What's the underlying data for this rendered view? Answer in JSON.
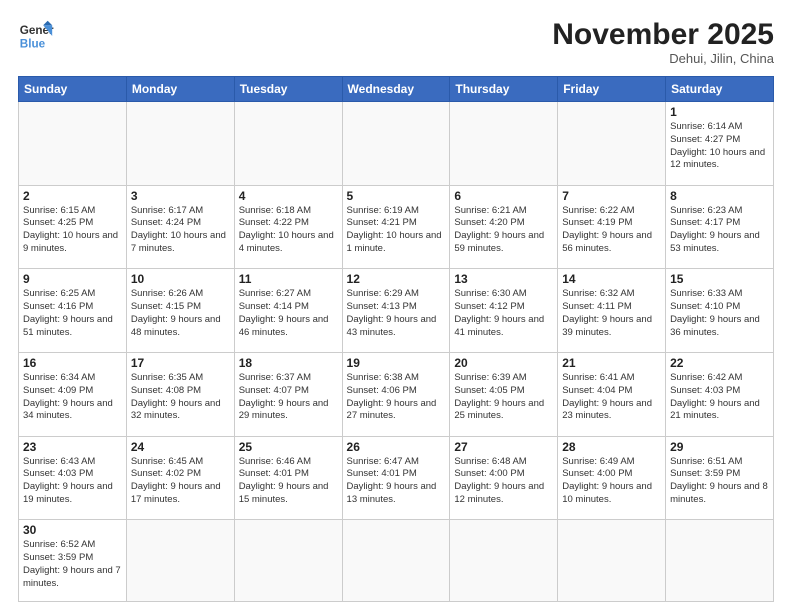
{
  "header": {
    "logo_general": "General",
    "logo_blue": "Blue",
    "month_title": "November 2025",
    "location": "Dehui, Jilin, China"
  },
  "weekdays": [
    "Sunday",
    "Monday",
    "Tuesday",
    "Wednesday",
    "Thursday",
    "Friday",
    "Saturday"
  ],
  "weeks": [
    [
      {
        "day": "",
        "info": ""
      },
      {
        "day": "",
        "info": ""
      },
      {
        "day": "",
        "info": ""
      },
      {
        "day": "",
        "info": ""
      },
      {
        "day": "",
        "info": ""
      },
      {
        "day": "",
        "info": ""
      },
      {
        "day": "1",
        "info": "Sunrise: 6:14 AM\nSunset: 4:27 PM\nDaylight: 10 hours and 12 minutes."
      }
    ],
    [
      {
        "day": "2",
        "info": "Sunrise: 6:15 AM\nSunset: 4:25 PM\nDaylight: 10 hours and 9 minutes."
      },
      {
        "day": "3",
        "info": "Sunrise: 6:17 AM\nSunset: 4:24 PM\nDaylight: 10 hours and 7 minutes."
      },
      {
        "day": "4",
        "info": "Sunrise: 6:18 AM\nSunset: 4:22 PM\nDaylight: 10 hours and 4 minutes."
      },
      {
        "day": "5",
        "info": "Sunrise: 6:19 AM\nSunset: 4:21 PM\nDaylight: 10 hours and 1 minute."
      },
      {
        "day": "6",
        "info": "Sunrise: 6:21 AM\nSunset: 4:20 PM\nDaylight: 9 hours and 59 minutes."
      },
      {
        "day": "7",
        "info": "Sunrise: 6:22 AM\nSunset: 4:19 PM\nDaylight: 9 hours and 56 minutes."
      },
      {
        "day": "8",
        "info": "Sunrise: 6:23 AM\nSunset: 4:17 PM\nDaylight: 9 hours and 53 minutes."
      }
    ],
    [
      {
        "day": "9",
        "info": "Sunrise: 6:25 AM\nSunset: 4:16 PM\nDaylight: 9 hours and 51 minutes."
      },
      {
        "day": "10",
        "info": "Sunrise: 6:26 AM\nSunset: 4:15 PM\nDaylight: 9 hours and 48 minutes."
      },
      {
        "day": "11",
        "info": "Sunrise: 6:27 AM\nSunset: 4:14 PM\nDaylight: 9 hours and 46 minutes."
      },
      {
        "day": "12",
        "info": "Sunrise: 6:29 AM\nSunset: 4:13 PM\nDaylight: 9 hours and 43 minutes."
      },
      {
        "day": "13",
        "info": "Sunrise: 6:30 AM\nSunset: 4:12 PM\nDaylight: 9 hours and 41 minutes."
      },
      {
        "day": "14",
        "info": "Sunrise: 6:32 AM\nSunset: 4:11 PM\nDaylight: 9 hours and 39 minutes."
      },
      {
        "day": "15",
        "info": "Sunrise: 6:33 AM\nSunset: 4:10 PM\nDaylight: 9 hours and 36 minutes."
      }
    ],
    [
      {
        "day": "16",
        "info": "Sunrise: 6:34 AM\nSunset: 4:09 PM\nDaylight: 9 hours and 34 minutes."
      },
      {
        "day": "17",
        "info": "Sunrise: 6:35 AM\nSunset: 4:08 PM\nDaylight: 9 hours and 32 minutes."
      },
      {
        "day": "18",
        "info": "Sunrise: 6:37 AM\nSunset: 4:07 PM\nDaylight: 9 hours and 29 minutes."
      },
      {
        "day": "19",
        "info": "Sunrise: 6:38 AM\nSunset: 4:06 PM\nDaylight: 9 hours and 27 minutes."
      },
      {
        "day": "20",
        "info": "Sunrise: 6:39 AM\nSunset: 4:05 PM\nDaylight: 9 hours and 25 minutes."
      },
      {
        "day": "21",
        "info": "Sunrise: 6:41 AM\nSunset: 4:04 PM\nDaylight: 9 hours and 23 minutes."
      },
      {
        "day": "22",
        "info": "Sunrise: 6:42 AM\nSunset: 4:03 PM\nDaylight: 9 hours and 21 minutes."
      }
    ],
    [
      {
        "day": "23",
        "info": "Sunrise: 6:43 AM\nSunset: 4:03 PM\nDaylight: 9 hours and 19 minutes."
      },
      {
        "day": "24",
        "info": "Sunrise: 6:45 AM\nSunset: 4:02 PM\nDaylight: 9 hours and 17 minutes."
      },
      {
        "day": "25",
        "info": "Sunrise: 6:46 AM\nSunset: 4:01 PM\nDaylight: 9 hours and 15 minutes."
      },
      {
        "day": "26",
        "info": "Sunrise: 6:47 AM\nSunset: 4:01 PM\nDaylight: 9 hours and 13 minutes."
      },
      {
        "day": "27",
        "info": "Sunrise: 6:48 AM\nSunset: 4:00 PM\nDaylight: 9 hours and 12 minutes."
      },
      {
        "day": "28",
        "info": "Sunrise: 6:49 AM\nSunset: 4:00 PM\nDaylight: 9 hours and 10 minutes."
      },
      {
        "day": "29",
        "info": "Sunrise: 6:51 AM\nSunset: 3:59 PM\nDaylight: 9 hours and 8 minutes."
      }
    ],
    [
      {
        "day": "30",
        "info": "Sunrise: 6:52 AM\nSunset: 3:59 PM\nDaylight: 9 hours and 7 minutes."
      },
      {
        "day": "",
        "info": ""
      },
      {
        "day": "",
        "info": ""
      },
      {
        "day": "",
        "info": ""
      },
      {
        "day": "",
        "info": ""
      },
      {
        "day": "",
        "info": ""
      },
      {
        "day": "",
        "info": ""
      }
    ]
  ]
}
